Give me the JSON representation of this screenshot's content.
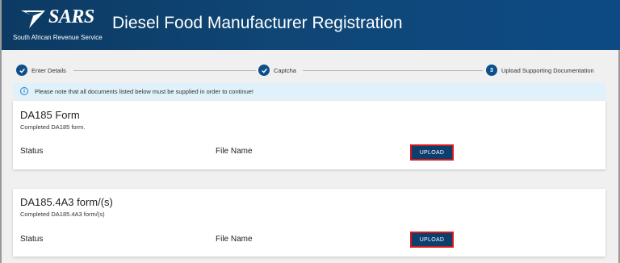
{
  "header": {
    "logo_text": "SARS",
    "logo_subtitle": "South African Revenue Service",
    "title": "Diesel Food Manufacturer Registration"
  },
  "stepper": {
    "steps": [
      {
        "label": "Enter Details",
        "state": "completed",
        "icon": "check-icon"
      },
      {
        "label": "Captcha",
        "state": "completed",
        "icon": "check-icon"
      },
      {
        "label": "Upload Supporting Documentation",
        "state": "active",
        "number": "3"
      }
    ]
  },
  "notice": {
    "icon": "info-icon",
    "text": "Please note that all documents listed below must be supplied in order to continue!"
  },
  "documents": [
    {
      "title": "DA185 Form",
      "description": "Completed DA185 form.",
      "status_label": "Status",
      "file_name_label": "File Name",
      "upload_label": "UPLOAD"
    },
    {
      "title": "DA185.4A3 form/(s)",
      "description": "Completed DA185.4A3 form/(s)",
      "status_label": "Status",
      "file_name_label": "File Name",
      "upload_label": "UPLOAD"
    }
  ],
  "colors": {
    "header_bg": "#0f4675",
    "step_accent": "#0d4f8b",
    "notice_bg": "#dff1fb",
    "upload_bg": "#0d3f6e",
    "upload_border": "#d11a1a"
  }
}
